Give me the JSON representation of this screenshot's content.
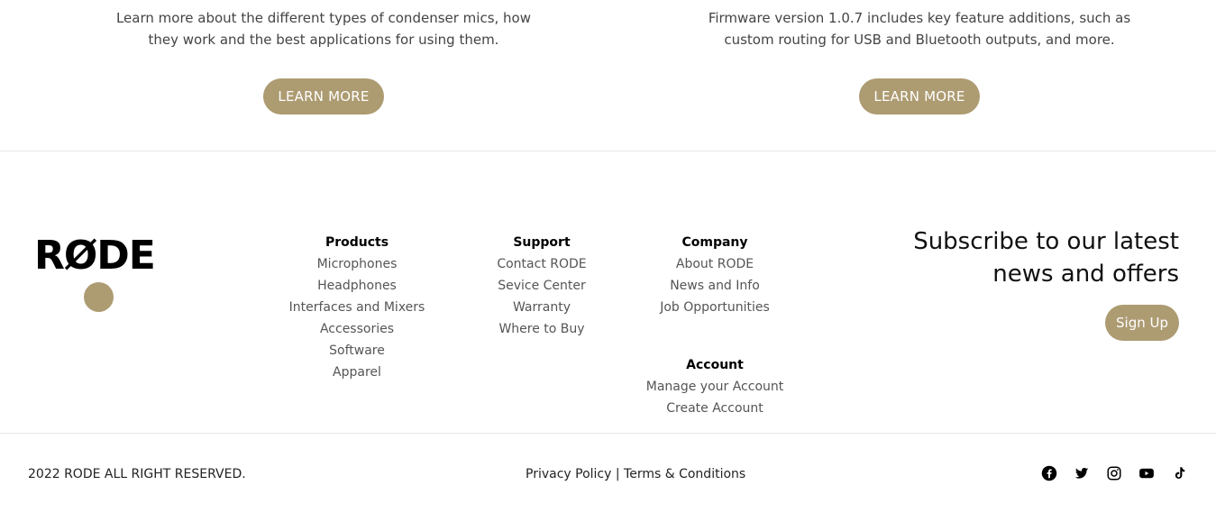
{
  "promo": {
    "left": {
      "text": "Learn more about the different types of condenser mics, how they work and the best applications for using them.",
      "button": "LEARN MORE"
    },
    "right": {
      "text": "Firmware version 1.0.7 includes key feature additions, such as custom routing for USB and Bluetooth outputs, and more.",
      "button": "LEARN MORE"
    }
  },
  "footer": {
    "logo": "RØDE",
    "products": {
      "title": "Products",
      "items": [
        "Microphones",
        "Headphones",
        "Interfaces and Mixers",
        "Accessories",
        "Software",
        "Apparel"
      ]
    },
    "support": {
      "title": "Support",
      "items": [
        "Contact RODE",
        "Sevice Center",
        "Warranty",
        "Where to Buy"
      ]
    },
    "company": {
      "title": "Company",
      "items": [
        "About RODE",
        "News and Info",
        "Job Opportunities"
      ]
    },
    "account": {
      "title": "Account",
      "items": [
        "Manage your Account",
        "Create Account"
      ]
    },
    "subscribe": {
      "line1": "Subscribe to our latest",
      "line2": "news and offers",
      "button": "Sign Up"
    }
  },
  "bottom": {
    "copyright": "2022 RODE ALL RIGHT RESERVED.",
    "privacy": "Privacy Policy",
    "separator": "|",
    "terms": "Terms & Conditions",
    "social": [
      "facebook-icon",
      "twitter-icon",
      "instagram-icon",
      "youtube-icon",
      "tiktok-icon"
    ]
  },
  "colors": {
    "accent": "#ad9b72",
    "text": "#444444",
    "divider": "#e6e6e6"
  }
}
